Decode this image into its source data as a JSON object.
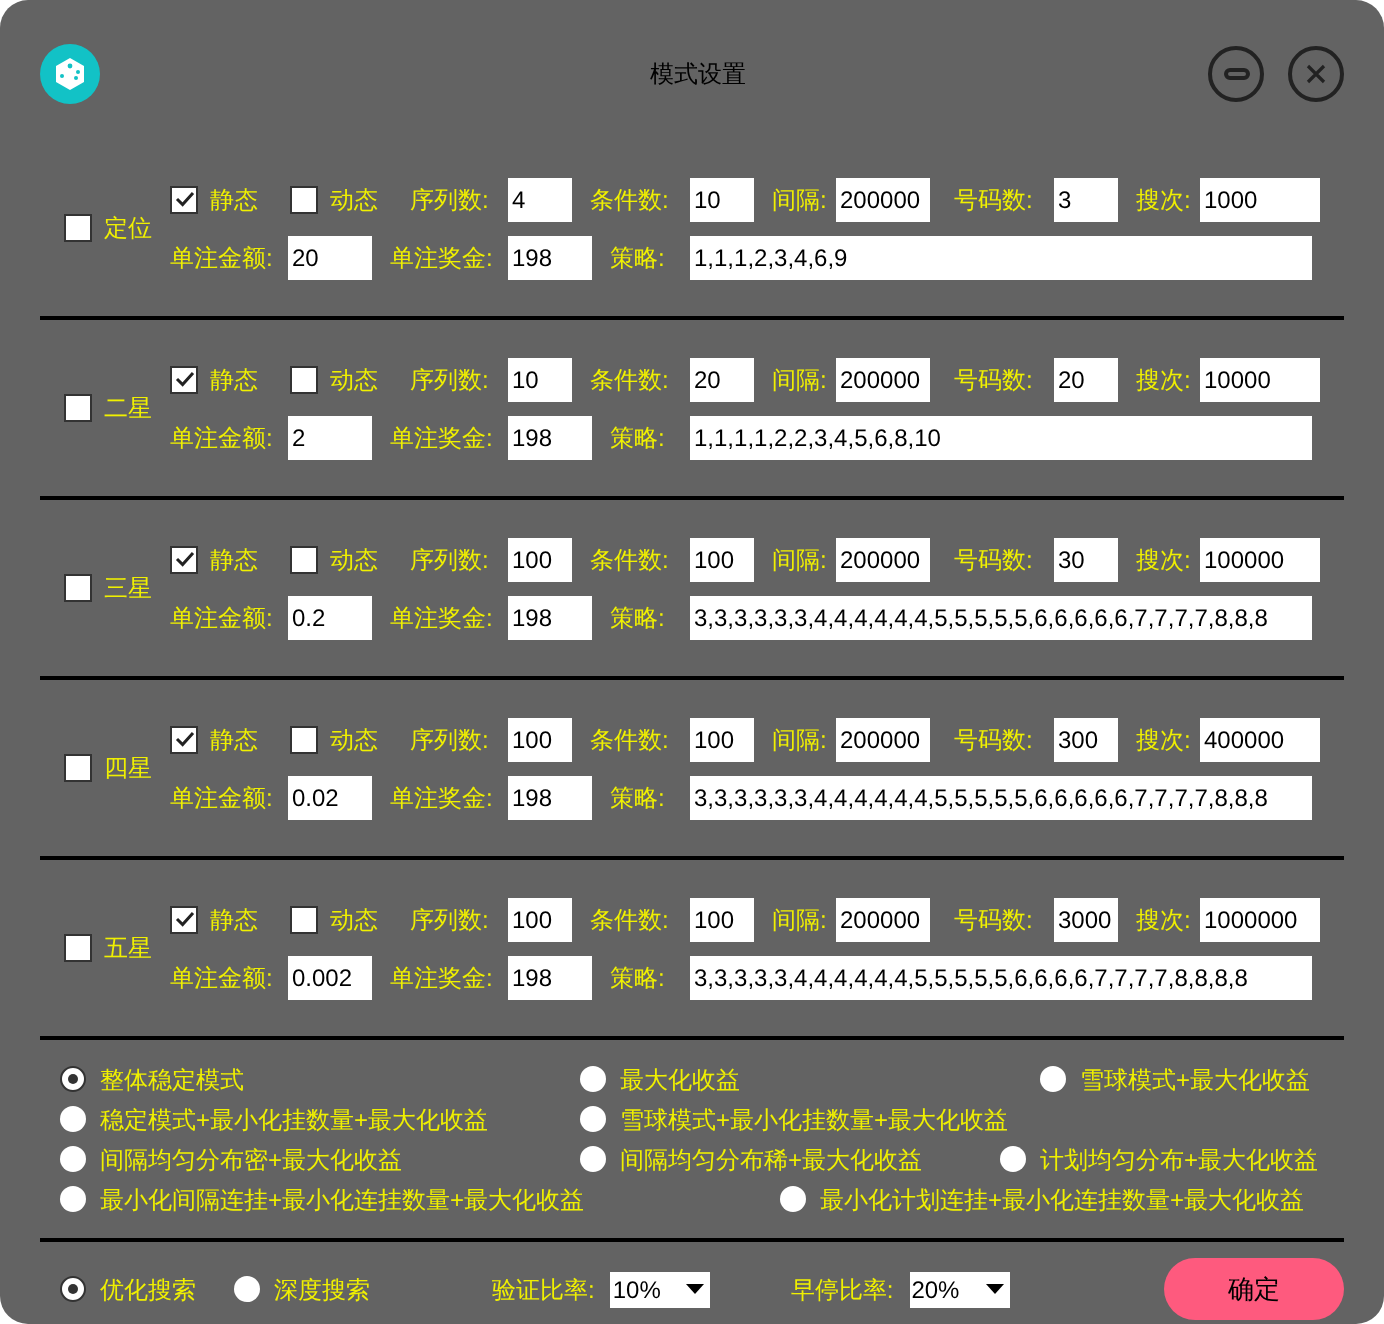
{
  "window": {
    "title": "模式设置"
  },
  "sections": [
    {
      "name": "定位",
      "checked": false,
      "static": {
        "label": "静态",
        "checked": true
      },
      "dynamic": {
        "label": "动态",
        "checked": false
      },
      "fields": [
        {
          "label": "序列数:",
          "value": "4"
        },
        {
          "label": "条件数:",
          "value": "10"
        },
        {
          "label": "间隔:",
          "value": "200000"
        },
        {
          "label": "号码数:",
          "value": "3"
        },
        {
          "label": "搜次:",
          "value": "1000"
        }
      ],
      "amount": {
        "label": "单注金额:",
        "value": "20"
      },
      "prize": {
        "label": "单注奖金:",
        "value": "198"
      },
      "strategy": {
        "label": "策略:",
        "value": "1,1,1,2,3,4,6,9"
      }
    },
    {
      "name": "二星",
      "checked": false,
      "static": {
        "label": "静态",
        "checked": true
      },
      "dynamic": {
        "label": "动态",
        "checked": false
      },
      "fields": [
        {
          "label": "序列数:",
          "value": "10"
        },
        {
          "label": "条件数:",
          "value": "20"
        },
        {
          "label": "间隔:",
          "value": "200000"
        },
        {
          "label": "号码数:",
          "value": "20"
        },
        {
          "label": "搜次:",
          "value": "10000"
        }
      ],
      "amount": {
        "label": "单注金额:",
        "value": "2"
      },
      "prize": {
        "label": "单注奖金:",
        "value": "198"
      },
      "strategy": {
        "label": "策略:",
        "value": "1,1,1,1,2,2,3,4,5,6,8,10"
      }
    },
    {
      "name": "三星",
      "checked": false,
      "static": {
        "label": "静态",
        "checked": true
      },
      "dynamic": {
        "label": "动态",
        "checked": false
      },
      "fields": [
        {
          "label": "序列数:",
          "value": "100"
        },
        {
          "label": "条件数:",
          "value": "100"
        },
        {
          "label": "间隔:",
          "value": "200000"
        },
        {
          "label": "号码数:",
          "value": "30"
        },
        {
          "label": "搜次:",
          "value": "100000"
        }
      ],
      "amount": {
        "label": "单注金额:",
        "value": "0.2"
      },
      "prize": {
        "label": "单注奖金:",
        "value": "198"
      },
      "strategy": {
        "label": "策略:",
        "value": "3,3,3,3,3,3,4,4,4,4,4,4,5,5,5,5,5,6,6,6,6,6,7,7,7,7,8,8,8"
      }
    },
    {
      "name": "四星",
      "checked": false,
      "static": {
        "label": "静态",
        "checked": true
      },
      "dynamic": {
        "label": "动态",
        "checked": false
      },
      "fields": [
        {
          "label": "序列数:",
          "value": "100"
        },
        {
          "label": "条件数:",
          "value": "100"
        },
        {
          "label": "间隔:",
          "value": "200000"
        },
        {
          "label": "号码数:",
          "value": "300"
        },
        {
          "label": "搜次:",
          "value": "400000"
        }
      ],
      "amount": {
        "label": "单注金额:",
        "value": "0.02"
      },
      "prize": {
        "label": "单注奖金:",
        "value": "198"
      },
      "strategy": {
        "label": "策略:",
        "value": "3,3,3,3,3,3,4,4,4,4,4,4,5,5,5,5,5,6,6,6,6,6,7,7,7,7,8,8,8"
      }
    },
    {
      "name": "五星",
      "checked": false,
      "static": {
        "label": "静态",
        "checked": true
      },
      "dynamic": {
        "label": "动态",
        "checked": false
      },
      "fields": [
        {
          "label": "序列数:",
          "value": "100"
        },
        {
          "label": "条件数:",
          "value": "100"
        },
        {
          "label": "间隔:",
          "value": "200000"
        },
        {
          "label": "号码数:",
          "value": "3000"
        },
        {
          "label": "搜次:",
          "value": "1000000"
        }
      ],
      "amount": {
        "label": "单注金额:",
        "value": "0.002"
      },
      "prize": {
        "label": "单注奖金:",
        "value": "198"
      },
      "strategy": {
        "label": "策略:",
        "value": "3,3,3,3,3,4,4,4,4,4,4,5,5,5,5,5,6,6,6,6,7,7,7,7,8,8,8,8"
      }
    }
  ],
  "modes": [
    [
      {
        "label": "整体稳定模式",
        "selected": true
      },
      {
        "label": "最大化收益",
        "selected": false
      },
      {
        "label": "雪球模式+最大化收益",
        "selected": false
      }
    ],
    [
      {
        "label": "稳定模式+最小化挂数量+最大化收益",
        "selected": false
      },
      {
        "label": "雪球模式+最小化挂数量+最大化收益",
        "selected": false
      }
    ],
    [
      {
        "label": "间隔均匀分布密+最大化收益",
        "selected": false
      },
      {
        "label": "间隔均匀分布稀+最大化收益",
        "selected": false
      },
      {
        "label": "计划均匀分布+最大化收益",
        "selected": false
      }
    ],
    [
      {
        "label": "最小化间隔连挂+最小化连挂数量+最大化收益",
        "selected": false
      },
      {
        "label": "最小化计划连挂+最小化连挂数量+最大化收益",
        "selected": false
      }
    ]
  ],
  "search": [
    {
      "label": "优化搜索",
      "selected": true
    },
    {
      "label": "深度搜索",
      "selected": false
    }
  ],
  "validation": {
    "label": "验证比率:",
    "value": "10%"
  },
  "early_stop": {
    "label": "早停比率:",
    "value": "20%"
  },
  "confirm": "确定"
}
